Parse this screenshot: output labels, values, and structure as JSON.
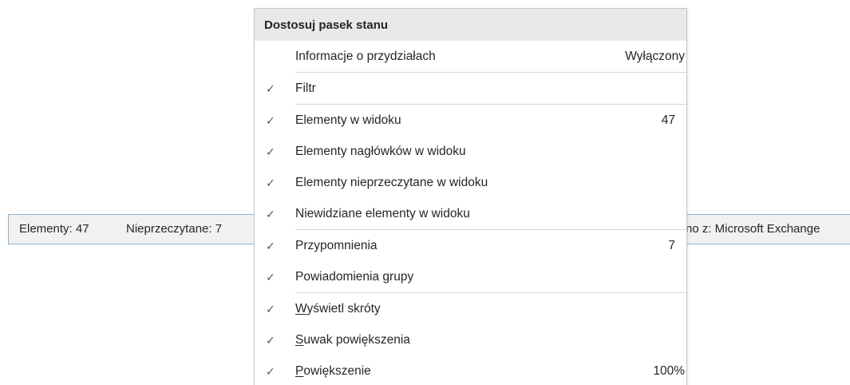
{
  "status_bar": {
    "items_count": "Elementy: 47",
    "unread_count": "Nieprzeczytane: 7",
    "connected_to": "no z: Microsoft Exchange"
  },
  "menu": {
    "title": "Dostosuj pasek stanu",
    "items": [
      {
        "label": "Informacje o przydziałach",
        "value": "Wyłączony",
        "checked": false
      },
      {
        "label": "Filtr",
        "value": "",
        "checked": true
      },
      {
        "label": "Elementy w widoku",
        "value": "47",
        "checked": true
      },
      {
        "label": "Elementy nagłówków w widoku",
        "value": "",
        "checked": true
      },
      {
        "label": "Elementy nieprzeczytane w widoku",
        "value": "",
        "checked": true
      },
      {
        "label": "Niewidziane elementy w widoku",
        "value": "",
        "checked": true
      },
      {
        "label": "Przypomnienia",
        "value": "7",
        "checked": true
      },
      {
        "label": "Powiadomienia grupy",
        "value": "",
        "checked": true
      },
      {
        "label_mnemonic": "W",
        "label_rest": "yświetl skróty",
        "value": "",
        "checked": true
      },
      {
        "label_mnemonic": "S",
        "label_rest": "uwak powiększenia",
        "value": "",
        "checked": true
      },
      {
        "label_mnemonic": "P",
        "label_rest": "owiększenie",
        "value": "100%",
        "checked": true
      }
    ],
    "check_glyph": "✓"
  },
  "colors": {
    "header_bg": "#e9e9e9",
    "statusbar_bg": "#f1f1f1",
    "statusbar_border": "#8fb1d1",
    "separator": "#d6d6d6"
  }
}
